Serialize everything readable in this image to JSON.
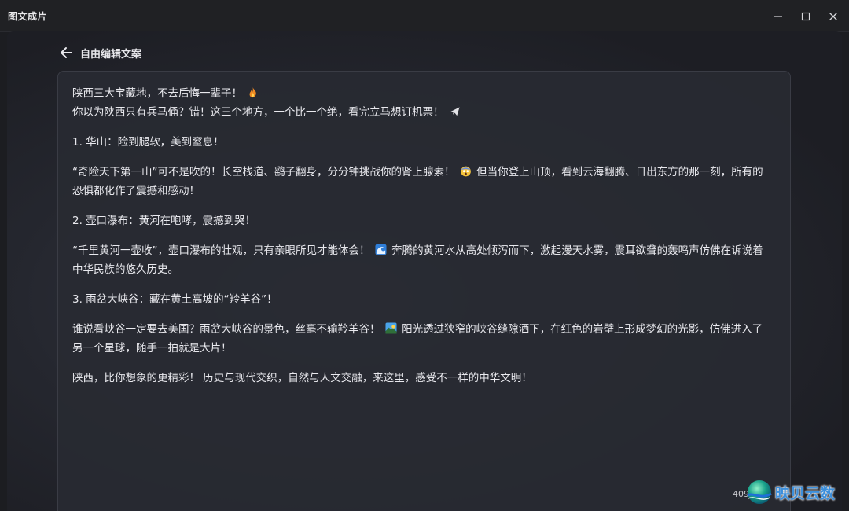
{
  "window": {
    "title": "图文成片"
  },
  "header": {
    "back_label": "自由编辑文案"
  },
  "editor": {
    "lines": {
      "l1": "陕西三大宝藏地，不去后悔一辈子！",
      "l2": "你以为陕西只有兵马俑？错！这三个地方，一个比一个绝，看完立马想订机票！",
      "l3": "1. 华山：险到腿软，美到窒息！",
      "l4a": "“奇险天下第一山”可不是吹的！长空栈道、鹞子翻身，分分钟挑战你的肾上腺素！",
      "l4b": "但当你登上山顶，看到云海翻腾、日出东方的那一刻，所有的恐惧都化作了震撼和感动！",
      "l5": "2. 壶口瀑布：黄河在咆哮，震撼到哭！",
      "l6a": "“千里黄河一壶收”，壶口瀑布的壮观，只有亲眼所见才能体会！",
      "l6b": "奔腾的黄河水从高处倾泻而下，激起漫天水雾，震耳欲聋的轰鸣声仿佛在诉说着中华民族的悠久历史。",
      "l7": "3. 雨岔大峡谷：藏在黄土高坡的“羚羊谷”！",
      "l8a": "谁说看峡谷一定要去美国？雨岔大峡谷的景色，丝毫不输羚羊谷！",
      "l8b": "阳光透过狭窄的峡谷缝隙洒下，在红色的岩壁上形成梦幻的光影，仿佛进入了另一个星球，随手一拍就是大片！",
      "l9": "陕西，比你想象的更精彩！ 历史与现代交织，自然与人文交融，来这里，感受不一样的中华文明！"
    },
    "icons": [
      "fire-emoji",
      "airplane-emoji",
      "scream-emoji",
      "wave-emoji",
      "sunrise-emoji"
    ],
    "char_count": "409"
  },
  "watermark": {
    "text": "映贝云数"
  }
}
